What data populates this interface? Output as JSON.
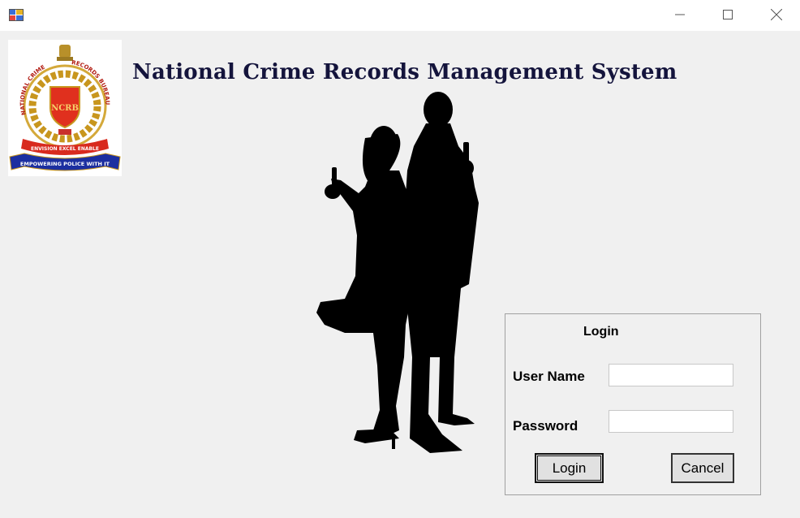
{
  "window": {
    "title": "",
    "controls": [
      "minimize",
      "maximize",
      "close"
    ]
  },
  "header": {
    "app_title": "National Crime Records Management System"
  },
  "emblem": {
    "text_arc_left": "NATIONAL CRIME",
    "text_arc_right": "RECORDS BUREAU",
    "ribbon_center": "EXCEL",
    "ribbon_left": "ENVISION",
    "ribbon_right": "ENABLE",
    "banner": "EMPOWERING POLICE WITH IT",
    "shield_text": "NCRB"
  },
  "login": {
    "group_title": "Login",
    "username_label": "User Name",
    "username_value": "",
    "password_label": "Password",
    "password_value": "",
    "login_button": "Login",
    "cancel_button": "Cancel"
  },
  "colors": {
    "title": "#14143c",
    "window_bg": "#f0f0f0",
    "emblem_gold": "#c8961e",
    "emblem_red": "#e0301e",
    "emblem_blue": "#1c2fa0"
  }
}
